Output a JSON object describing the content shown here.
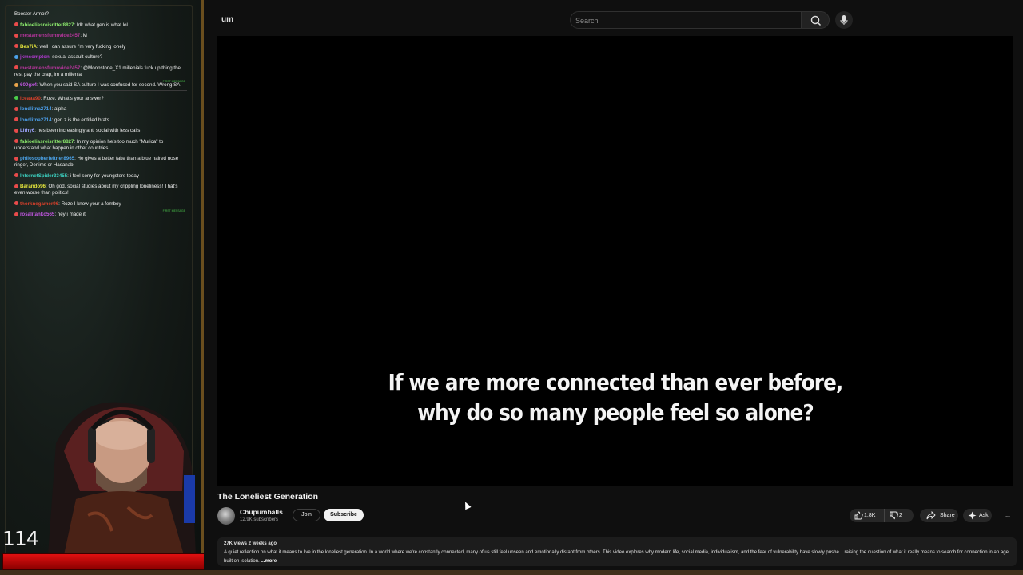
{
  "chat": {
    "top_line": "Booster Armor?",
    "messages": [
      {
        "user": "fabioeliasreisritter8827",
        "text": "Idk what gen is what lol",
        "user_color": "#8ae66b",
        "icon_color": "#e94b4b",
        "first": false
      },
      {
        "user": "mestamensfumnvide2457",
        "text": "M",
        "user_color": "#b5359b",
        "icon_color": "#e94b4b",
        "first": false
      },
      {
        "user": "Bes7iA",
        "text": "well i can assure i'm very fucking lonely",
        "user_color": "#e6e63c",
        "icon_color": "#e94b4b",
        "first": false
      },
      {
        "user": "jkmcompton",
        "text": "sexual assault culture?",
        "user_color": "#b03ad0",
        "icon_color": "#4ba3e9",
        "first": false
      },
      {
        "user": "mestamensfumnvide2457",
        "text": "@Moonstone_X1 millenials fuck up thing the rest pay the crap, im a millenial",
        "user_color": "#b5359b",
        "icon_color": "#e94b4b",
        "first": false
      },
      {
        "user": "600gx4",
        "text": "When you said SA culture I was confused for second. Wrong SA",
        "user_color": "#c056e0",
        "icon_color": "#e9a54b",
        "first": true
      },
      {
        "user": "Iceaaa90",
        "text": "Roze. What's your answer?",
        "user_color": "#d6402b",
        "icon_color": "#4bd04b",
        "first": false
      },
      {
        "user": "londlitna2714",
        "text": "alpha",
        "user_color": "#4b9de9",
        "icon_color": "#e94b4b",
        "first": false
      },
      {
        "user": "londlitna2714",
        "text": "gen z is the entitled brats",
        "user_color": "#4b9de9",
        "icon_color": "#e94b4b",
        "first": false
      },
      {
        "user": "Lithy6",
        "text": "hes been increasingly anti social with less calls",
        "user_color": "#9ea6ff",
        "icon_color": "#e94b4b",
        "first": false
      },
      {
        "user": "fabioeliasreisritter8827",
        "text": "In my opinion he's too much \"Murica\" to understand what happen in other countries",
        "user_color": "#8ae66b",
        "icon_color": "#e94b4b",
        "first": false
      },
      {
        "user": "philosopherfeltner8965",
        "text": "He gives a better take than a blue haired nose ringer, Denims or Hasanabi",
        "user_color": "#4ba3e9",
        "icon_color": "#e94b4b",
        "first": false
      },
      {
        "user": "InternetSpider33455",
        "text": "i feel sorry for youngsters today",
        "user_color": "#3cd0c0",
        "icon_color": "#e94b4b",
        "first": false
      },
      {
        "user": "Barando96",
        "text": "Oh god, social studies about my crippling loneliness! That's even worse than politics!",
        "user_color": "#e6e63c",
        "icon_color": "#e94b4b",
        "first": false
      },
      {
        "user": "thorknegamer96",
        "text": "Roze I know your a femboy",
        "user_color": "#d6402b",
        "icon_color": "#e94b4b",
        "first": false
      },
      {
        "user": "rosalitanko565",
        "text": "hey i made it",
        "user_color": "#c056e0",
        "icon_color": "#e94b4b",
        "first": true
      }
    ],
    "first_message_tag": "FIRST MESSAGE"
  },
  "stream": {
    "counter": "114"
  },
  "youtube": {
    "logo_text": "um",
    "search_placeholder": "Search",
    "caption_line1": "If we are more connected than ever before,",
    "caption_line2": "why do so many people feel so alone?",
    "video_title": "The Loneliest Generation",
    "channel_name": "Chupumballs",
    "subscribers": "12.9K subscribers",
    "join_label": "Join",
    "subscribe_label": "Subscribe",
    "likes": "1.8K",
    "dislikes": "2",
    "share_label": "Share",
    "ask_label": "Ask",
    "more_label": "...",
    "views_date": "27K views  2 weeks ago",
    "description": "A quiet reflection on what it means to live in the loneliest generation. In a world where we're constantly connected, many of us still feel unseen and emotionally distant from others. This video explores why modern life, social media, individualism, and the fear of vulnerability have slowly pushe... raising the question of what it really means to search for connection in an age built on isolation.",
    "desc_more": "...more"
  },
  "colors": {
    "accent_red": "#e01010",
    "frame_gold": "#6a4e1e",
    "yt_bg": "#0f0f0f"
  }
}
